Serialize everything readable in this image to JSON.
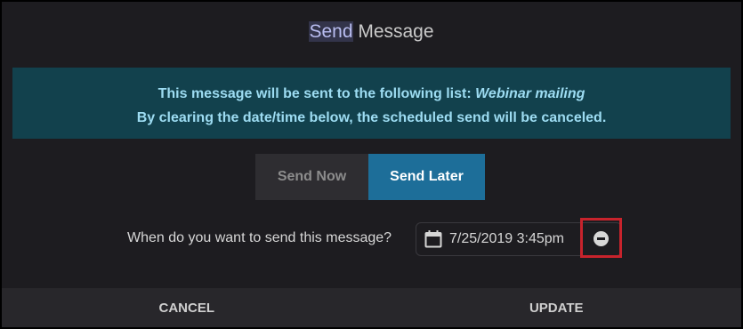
{
  "dialog": {
    "title_highlight": "Send",
    "title_rest": " Message"
  },
  "banner": {
    "line1_prefix": "This message will be sent to the following list: ",
    "list_name": "Webinar mailing",
    "line2": "By clearing the date/time below, the scheduled send will be canceled."
  },
  "toggle": {
    "send_now_label": "Send Now",
    "send_later_label": "Send Later",
    "selected": "Send Later"
  },
  "schedule": {
    "question": "When do you want to send this message?",
    "datetime_value": "7/25/2019 3:45pm",
    "date_icon": "calendar-icon",
    "clear_icon": "minus-circle-icon"
  },
  "footer": {
    "cancel_label": "CANCEL",
    "update_label": "UPDATE"
  },
  "colors": {
    "banner_bg": "#12414d",
    "banner_text": "#9ddcf2",
    "selected_segment": "#1d6e99",
    "clear_highlight_border": "#c8232c"
  }
}
